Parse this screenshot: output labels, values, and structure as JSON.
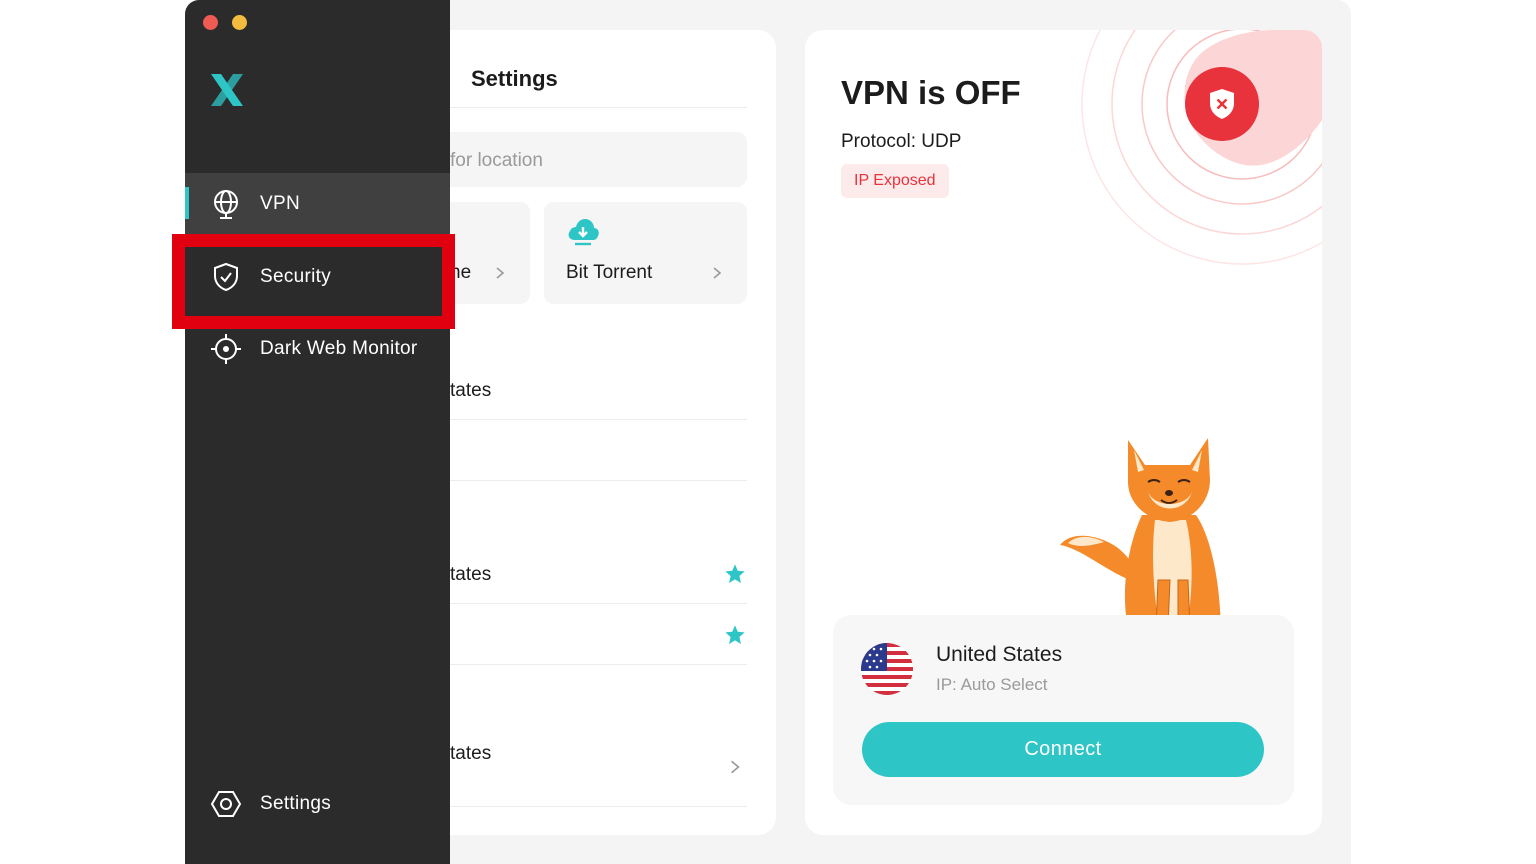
{
  "sidebar": {
    "items": [
      {
        "label": "VPN",
        "icon": "globe-icon",
        "active": true
      },
      {
        "label": "Security",
        "icon": "shield-icon",
        "active": false
      },
      {
        "label": "Dark Web Monitor",
        "icon": "target-icon",
        "active": false
      }
    ],
    "settings_label": "Settings"
  },
  "middle": {
    "title": "Settings",
    "search_placeholder": "for location",
    "cards": [
      {
        "label": "ne"
      },
      {
        "label": "Bit Torrent",
        "icon": "cloud-download-icon"
      }
    ],
    "rows": [
      {
        "label": "tates"
      },
      {
        "label": "tates",
        "starred": true
      },
      {
        "label": "",
        "starred": true
      },
      {
        "label": "tates"
      }
    ]
  },
  "status": {
    "title": "VPN is OFF",
    "protocol": "Protocol: UDP",
    "badge": "IP Exposed"
  },
  "location": {
    "country": "United States",
    "ip": "IP: Auto Select",
    "connect_label": "Connect"
  },
  "colors": {
    "accent": "#2ec5c7",
    "danger": "#e8323c",
    "sidebar_bg": "#2b2b2b",
    "highlight": "#e1000f"
  }
}
